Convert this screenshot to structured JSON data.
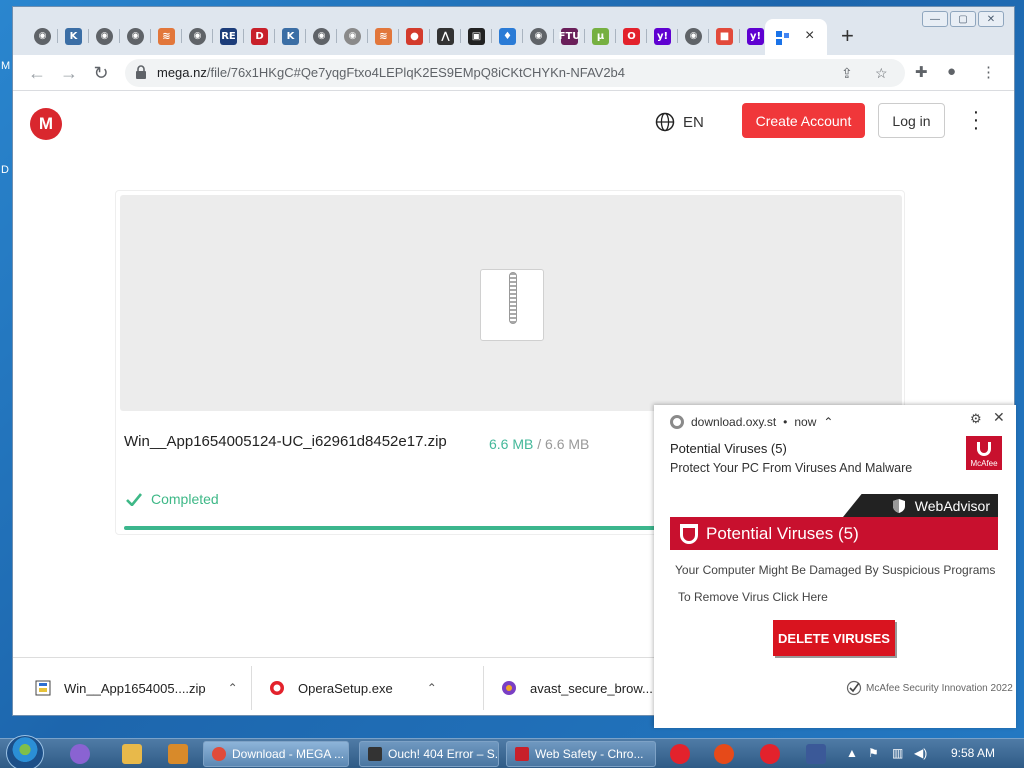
{
  "desktop": {
    "left_letters": [
      "M",
      "D"
    ]
  },
  "browser": {
    "tabs": [
      {
        "icon": "globe-icon",
        "color": "#5f6368",
        "glyph": "◉"
      },
      {
        "icon": "k-icon",
        "color": "#3b6ea5",
        "glyph": "K"
      },
      {
        "icon": "globe-icon",
        "color": "#5f6368",
        "glyph": "◉"
      },
      {
        "icon": "globe-icon",
        "color": "#5f6368",
        "glyph": "◉"
      },
      {
        "icon": "stack-icon",
        "color": "#e2773b",
        "glyph": "≋"
      },
      {
        "icon": "globe-icon",
        "color": "#5f6368",
        "glyph": "◉"
      },
      {
        "icon": "re-icon",
        "color": "#1c3d7a",
        "glyph": "RE"
      },
      {
        "icon": "d-icon",
        "color": "#c8202a",
        "glyph": "D"
      },
      {
        "icon": "k-icon",
        "color": "#3b6ea5",
        "glyph": "K"
      },
      {
        "icon": "globe-icon",
        "color": "#5f6368",
        "glyph": "◉"
      },
      {
        "icon": "globe-icon",
        "color": "#8a8a8a",
        "glyph": "◉"
      },
      {
        "icon": "stack-icon",
        "color": "#e2773b",
        "glyph": "≋"
      },
      {
        "icon": "red-circle-icon",
        "color": "#d33b2c",
        "glyph": "●"
      },
      {
        "icon": "caret-icon",
        "color": "#333333",
        "glyph": "⋀"
      },
      {
        "icon": "terminal-icon",
        "color": "#222222",
        "glyph": "▣"
      },
      {
        "icon": "flame-icon",
        "color": "#2a7bd6",
        "glyph": "♦"
      },
      {
        "icon": "globe-icon",
        "color": "#5f6368",
        "glyph": "◉"
      },
      {
        "icon": "ftu-icon",
        "color": "#6a1f5a",
        "glyph": "FTU"
      },
      {
        "icon": "utorrent-icon",
        "color": "#76b041",
        "glyph": "µ"
      },
      {
        "icon": "opera-icon",
        "color": "#e3222c",
        "glyph": "O"
      },
      {
        "icon": "yahoo-icon",
        "color": "#5f01d1",
        "glyph": "y!"
      },
      {
        "icon": "globe-icon",
        "color": "#5f6368",
        "glyph": "◉"
      },
      {
        "icon": "cube-icon",
        "color": "#e24a3b",
        "glyph": "■"
      },
      {
        "icon": "yahoo-icon",
        "color": "#5f01d1",
        "glyph": "y!"
      }
    ],
    "active_tab_close": "×",
    "new_tab": "+",
    "url_host": "mega.nz",
    "url_path": "/file/76x1HKgC#Qe7yqgFtxo4LEPlqK2ES9EMpQ8iCKtCHYKn-NFAV2b4"
  },
  "mega": {
    "logo_letter": "M",
    "lang": "EN",
    "create_account": "Create Account",
    "login": "Log in",
    "file_name": "Win__App1654005124-UC_i62961d8452e17.zip",
    "size_done": "6.6 MB",
    "size_sep": " / ",
    "size_total": "6.6 MB",
    "status": "Completed",
    "progress": 1.0
  },
  "downloads": [
    {
      "name": "Win__App1654005....zip",
      "icon": "zip-file-icon"
    },
    {
      "name": "OperaSetup.exe",
      "icon": "opera-setup-icon"
    },
    {
      "name": "avast_secure_brow....e",
      "icon": "avast-icon"
    }
  ],
  "notification": {
    "source": "download.oxy.st",
    "when": "now",
    "title": "Potential Viruses (5)",
    "message": "Protect Your PC From Viruses And Malware",
    "brand_small": "McAfee",
    "banner_top": "WebAdvisor",
    "banner_main": "Potential Viruses (5)",
    "body1": "Your Computer Might Be Damaged By Suspicious Programs",
    "body2": "To Remove Virus Click Here",
    "button": "DELETE VIRUSES",
    "footer": "McAfee Security Innovation 2022"
  },
  "taskbar": {
    "tasks": [
      {
        "label": "Download - MEGA ...",
        "icon_color": "#e04b3a"
      },
      {
        "label": "Ouch! 404 Error – S...",
        "icon_color": "#333333"
      },
      {
        "label": "Web Safety - Chro...",
        "icon_color": "#c8202a"
      }
    ],
    "clock": "9:58 AM"
  }
}
